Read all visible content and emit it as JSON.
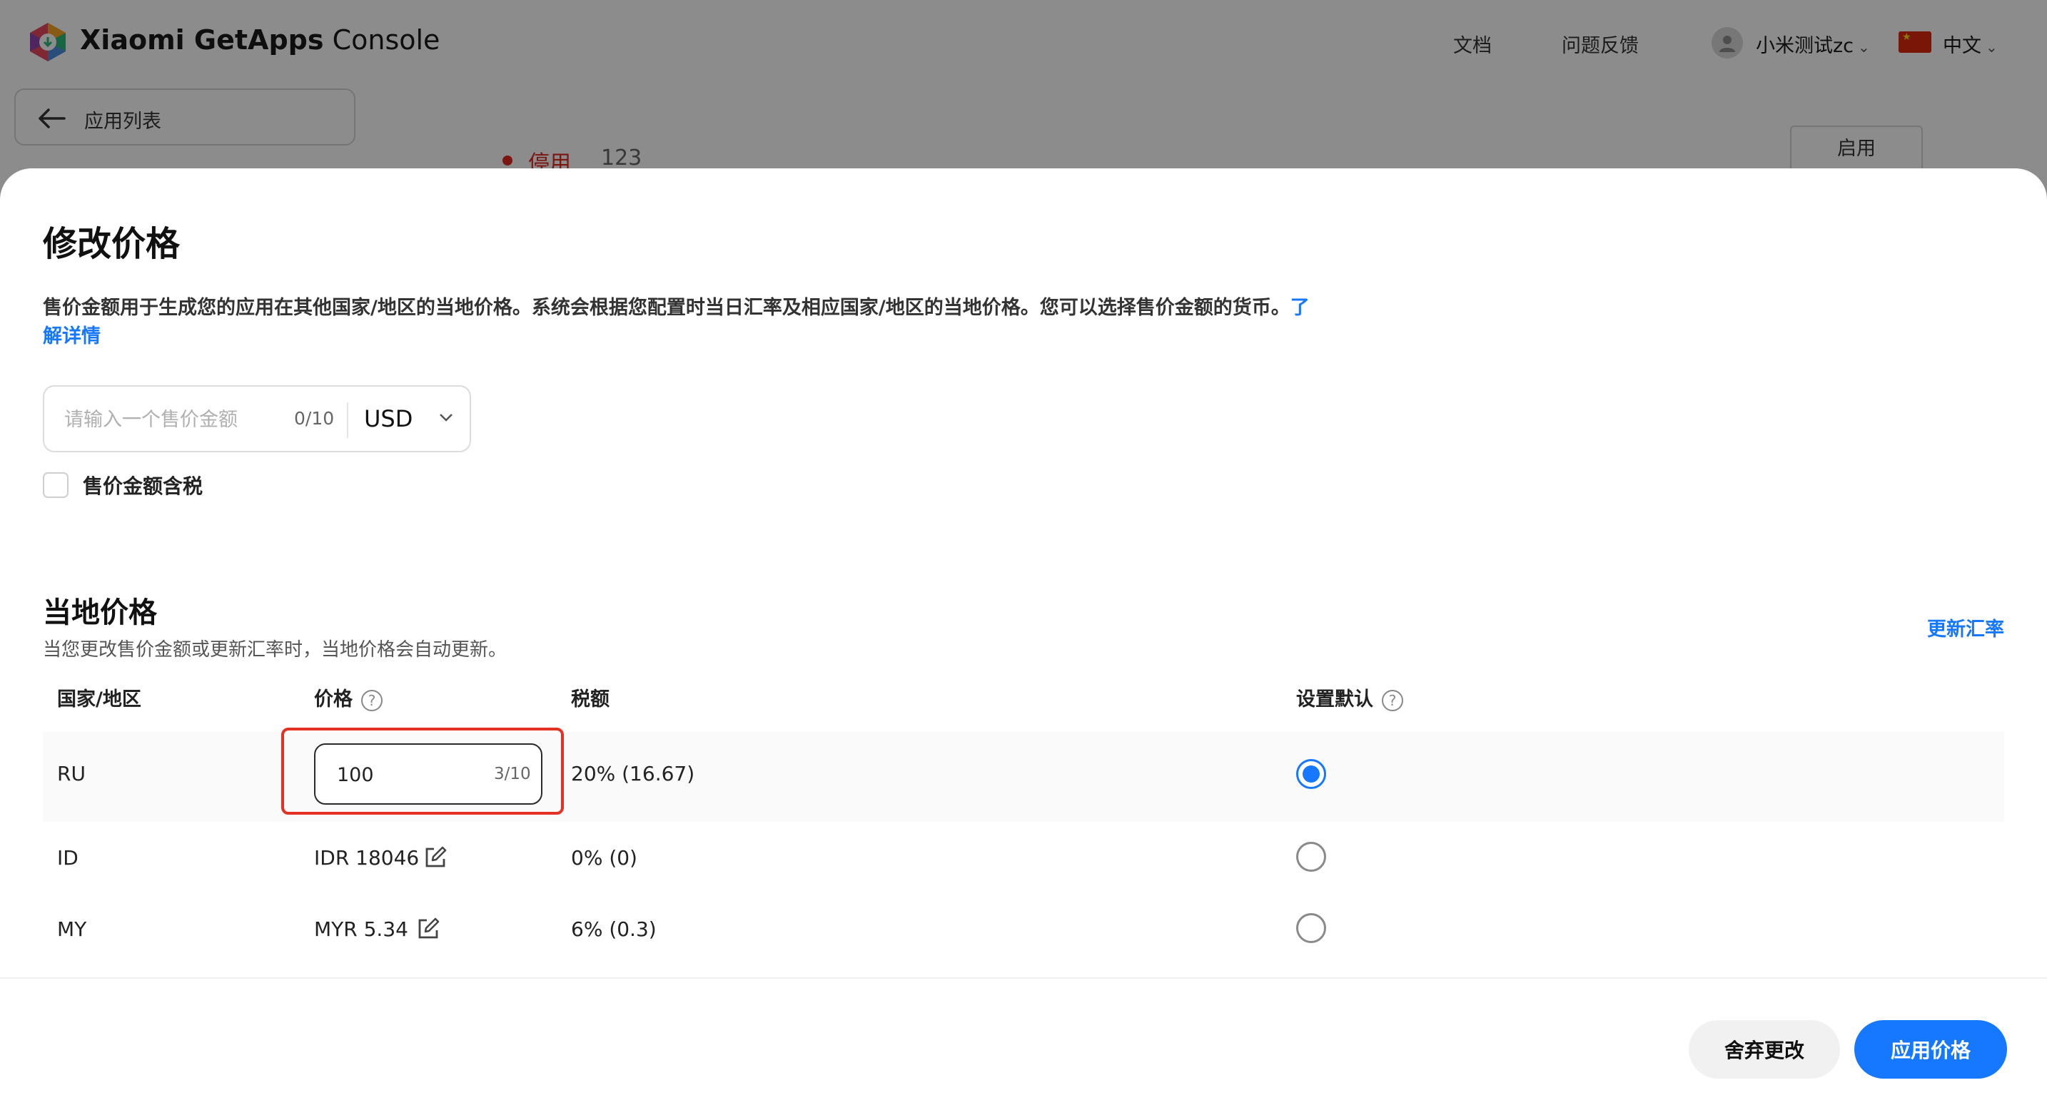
{
  "header": {
    "brand_bold": "Xiaomi GetApps",
    "brand_light": "Console",
    "docs_link": "文档",
    "feedback_link": "问题反馈",
    "user_name": "小米测试zc",
    "language": "中文",
    "flag_icon": "china-flag-icon",
    "avatar_icon": "user-avatar-icon"
  },
  "background": {
    "back_label": "应用列表",
    "status_label": "停用",
    "status_value": "123",
    "enable_button": "启用"
  },
  "modal": {
    "title": "修改价格",
    "description": "售价金额用于生成您的应用在其他国家/地区的当地价格。系统会根据您配置时当日汇率及相应国家/地区的当地价格。您可以选择售价金额的货币。",
    "learn_more": "了解详情",
    "price_input": {
      "placeholder": "请输入一个售价金额",
      "value": "",
      "counter": "0/10",
      "currency": "USD"
    },
    "tax_included_label": "售价金额含税",
    "tax_included_checked": false
  },
  "local_prices": {
    "title": "当地价格",
    "subtitle": "当您更改售价金额或更新汇率时，当地价格会自动更新。",
    "update_rate_link": "更新汇率",
    "headers": {
      "country": "国家/地区",
      "price": "价格",
      "tax": "税额",
      "default": "设置默认"
    },
    "rows": [
      {
        "country": "RU",
        "price": "100",
        "price_counter": "3/10",
        "editing": true,
        "tax": "20% (16.67)",
        "is_default": true
      },
      {
        "country": "ID",
        "price": "IDR 18046",
        "editing": false,
        "tax": "0% (0)",
        "is_default": false
      },
      {
        "country": "MY",
        "price": "MYR 5.34",
        "editing": false,
        "tax": "6% (0.3)",
        "is_default": false
      }
    ]
  },
  "footer": {
    "discard_button": "舍弃更改",
    "apply_button": "应用价格"
  },
  "colors": {
    "accent": "#1677ff",
    "highlight_border": "#e53123",
    "disabled_status": "#e0281e"
  }
}
